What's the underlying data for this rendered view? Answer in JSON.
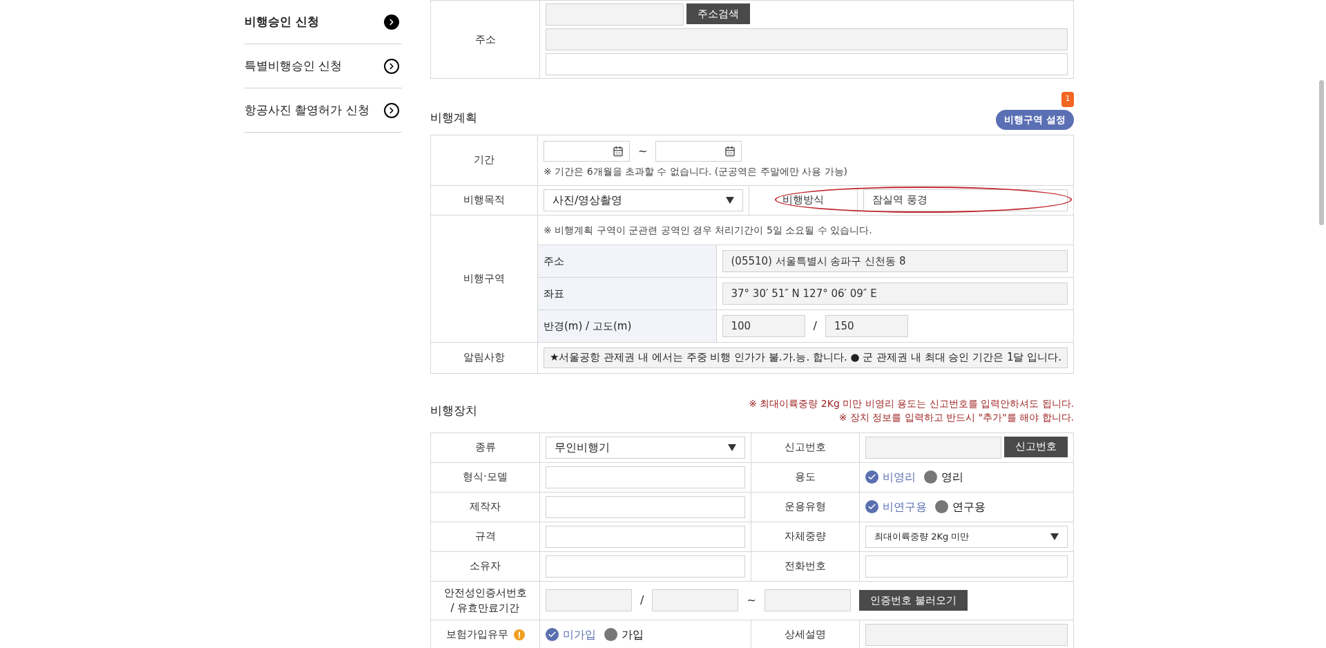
{
  "sidebar": {
    "items": [
      {
        "label": "비행승인 신청",
        "selected": true
      },
      {
        "label": "특별비행승인 신청",
        "selected": false
      },
      {
        "label": "항공사진 촬영허가 신청",
        "selected": false
      }
    ]
  },
  "address_section": {
    "label": "주소",
    "search_button": "주소검색"
  },
  "flight_plan": {
    "title": "비행계획",
    "zone_button": "비행구역 설정",
    "zone_badge": "1",
    "period": {
      "label": "기간",
      "separator": "~",
      "note": "※ 기간은 6개월을 초과할 수 없습니다. (군공역은 주말에만 사용 가능)"
    },
    "purpose": {
      "label": "비행목적",
      "value": "사진/영상촬영"
    },
    "method": {
      "label": "비행방식",
      "value": "잠실역 풍경"
    },
    "area": {
      "label": "비행구역",
      "note": "※ 비행계획 구역이 군관련 공역인 경우 처리기간이 5일 소요될 수 있습니다.",
      "address_label": "주소",
      "address": "(05510) 서울특별시 송파구 신천동 8",
      "coord_label": "좌표",
      "coords": "37° 30′ 51″ N 127° 06′ 09″ E",
      "radius_label": "반경(m) / 고도(m)",
      "radius": "100",
      "separator": "/",
      "altitude": "150"
    },
    "notice": {
      "label": "알림사항",
      "text": "★서울공항 관제권 내 에서는 주중 비행 인가가 불.가.능. 합니다. ● 군 관제권 내 최대 승인 기간은 1달 입니다."
    }
  },
  "device": {
    "title": "비행장치",
    "warnings": [
      "※ 최대이륙중량 2Kg 미만 비영리 용도는 신고번호를 입력안하셔도 됩니다.",
      "※ 장치 정보를 입력하고 반드시 \"추가\"를 해야 합니다."
    ],
    "kind": {
      "label": "종류",
      "value": "무인비행기"
    },
    "report_no": {
      "label": "신고번호",
      "button": "신고번호"
    },
    "model": {
      "label": "형식·모델"
    },
    "usage": {
      "label": "용도",
      "options": [
        {
          "label": "비영리",
          "selected": true
        },
        {
          "label": "영리",
          "selected": false
        }
      ]
    },
    "maker": {
      "label": "제작자"
    },
    "op_type": {
      "label": "운용유형",
      "options": [
        {
          "label": "비연구용",
          "selected": true
        },
        {
          "label": "연구용",
          "selected": false
        }
      ]
    },
    "spec": {
      "label": "규격"
    },
    "weight": {
      "label": "자체중량",
      "value": "최대이륙중량 2Kg 미만"
    },
    "owner": {
      "label": "소유자"
    },
    "phone": {
      "label": "전화번호"
    },
    "safety": {
      "label_lines": [
        "안전성인증서번호",
        "/ 유효만료기간"
      ],
      "separator1": "/",
      "separator2": "~",
      "button": "인증번호 불러오기"
    },
    "insurance": {
      "label": "보험가입유무",
      "options": [
        {
          "label": "미가입",
          "selected": true
        },
        {
          "label": "가입",
          "selected": false
        }
      ]
    },
    "detail": {
      "label": "상세설명"
    }
  }
}
